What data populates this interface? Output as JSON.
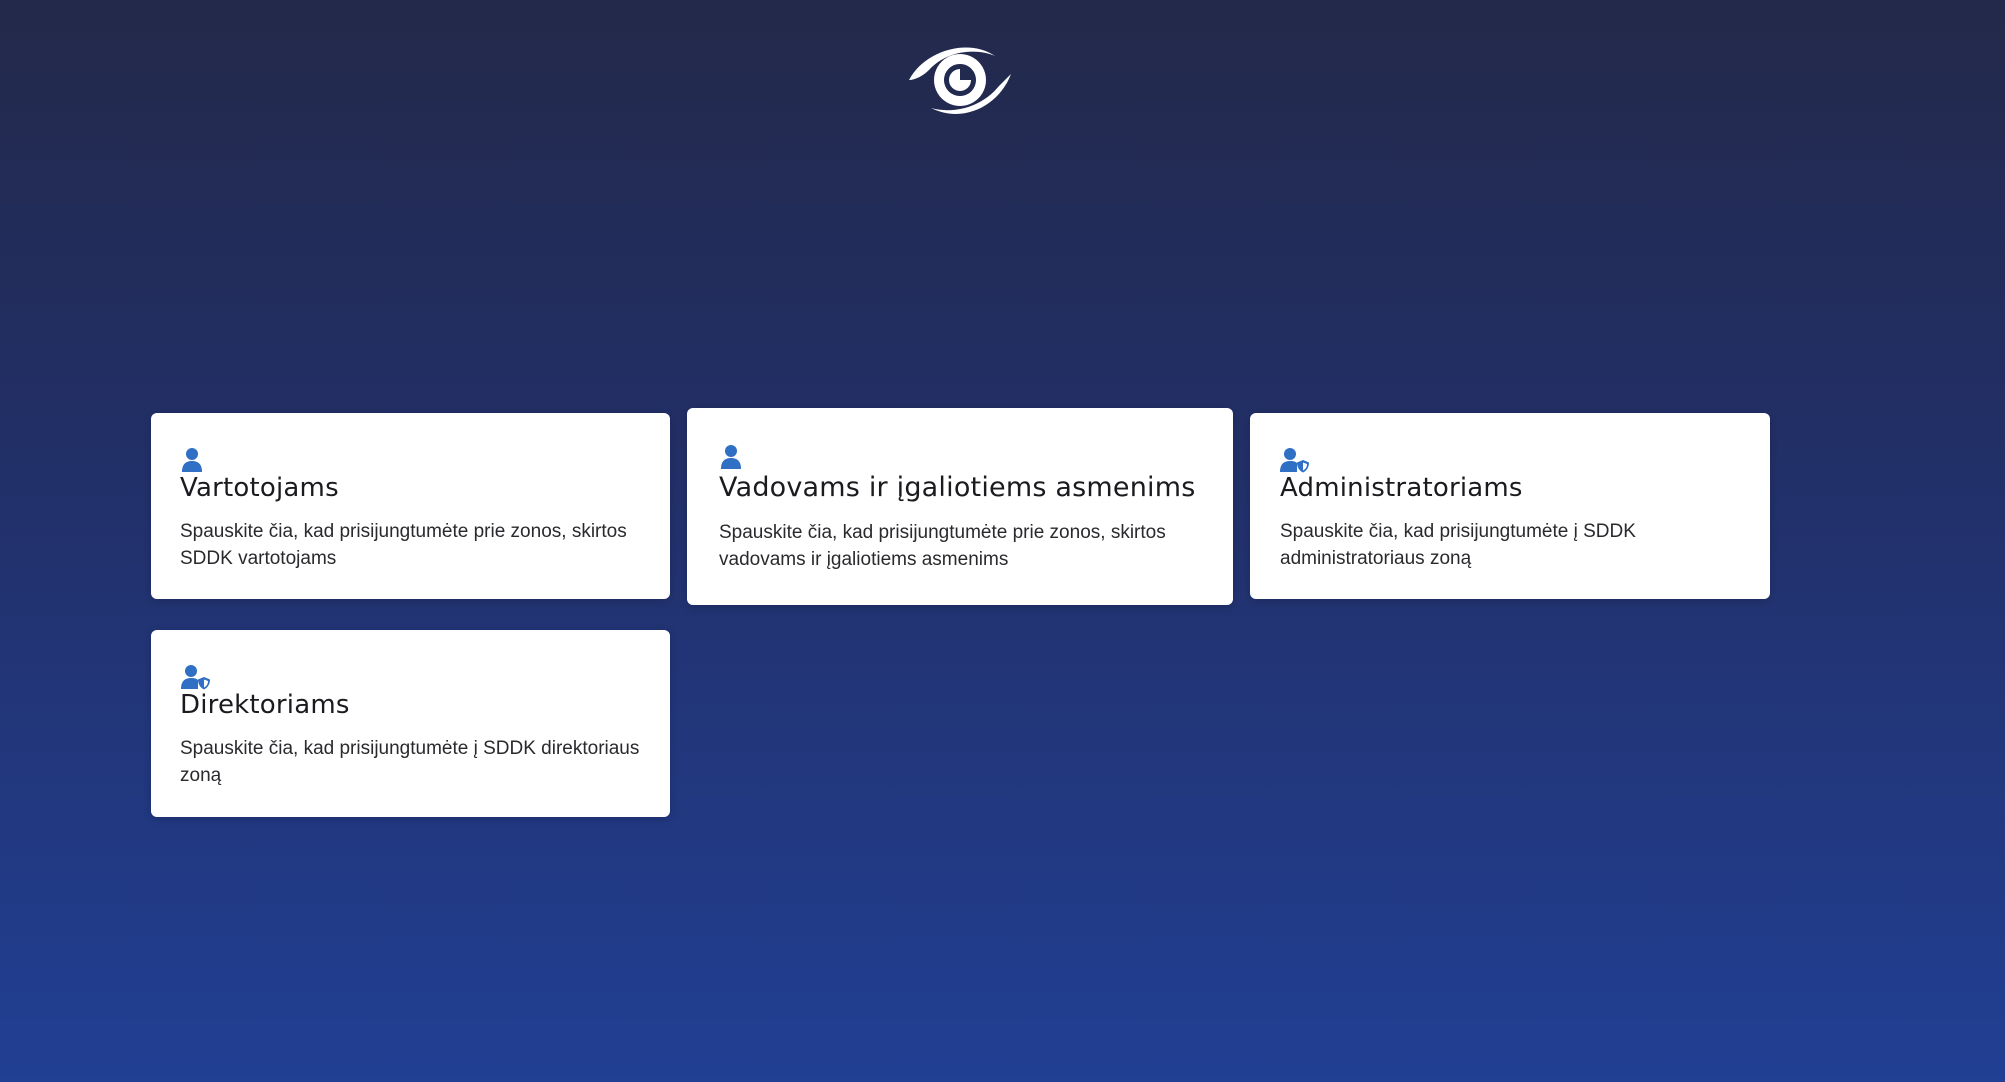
{
  "logo": {
    "icon": "eye-logo-icon"
  },
  "accent_color": "#2f6fc4",
  "cards": [
    {
      "icon": "user-icon",
      "title": "Vartotojams",
      "description": "Spauskite čia, kad prisijungtumėte prie zonos, skirtos SDDK vartotojams"
    },
    {
      "icon": "user-icon",
      "title": "Vadovams ir įgaliotiems asmenims",
      "description": "Spauskite čia, kad prisijungtumėte prie zonos, skirtos vadovams ir įgaliotiems asmenims"
    },
    {
      "icon": "user-shield-icon",
      "title": "Administratoriams",
      "description": "Spauskite čia, kad prisijungtumėte į SDDK administratoriaus zoną"
    },
    {
      "icon": "user-shield-icon",
      "title": "Direktoriams",
      "description": "Spauskite čia, kad prisijungtumėte į SDDK direktoriaus zoną"
    }
  ]
}
